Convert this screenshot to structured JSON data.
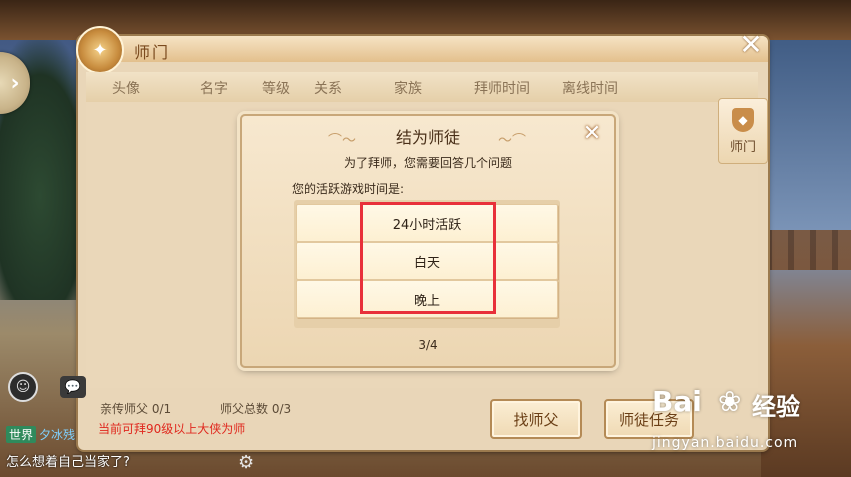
{
  "window": {
    "title": "师门"
  },
  "columns": [
    "头像",
    "名字",
    "等级",
    "关系",
    "家族",
    "拜师时间",
    "离线时间"
  ],
  "side_tab": {
    "label": "师门"
  },
  "dialog": {
    "title": "结为师徒",
    "subtitle": "为了拜师，您需要回答几个问题",
    "question": "您的活跃游戏时间是:",
    "options": [
      "24小时活跃",
      "白天",
      "晚上"
    ],
    "page": "3/4"
  },
  "stats": {
    "direct_master": "亲传师父 0/1",
    "master_total": "师父总数 0/3"
  },
  "notice": "当前可拜90级以上大侠为师",
  "buttons": {
    "find_master": "找师父",
    "apprentice": "师徒任务"
  },
  "chat": {
    "channel_tag": "世界",
    "sender": "夕冰残",
    "message": "怎么想着自己当家了?"
  },
  "watermark": {
    "brand": "Bai",
    "brand_cn": "经验",
    "url": "jingyan.baidu.com"
  },
  "icons": {
    "side_arrow": "chevron-right-icon",
    "emblem": "sect-emblem-icon",
    "close": "close-icon",
    "gear": "gear-icon",
    "avatar": "person-icon",
    "chat": "chat-icon"
  },
  "colors": {
    "highlight": "#e8303a",
    "notice": "#e0281e",
    "chat_tag": "#2f8a5c"
  }
}
